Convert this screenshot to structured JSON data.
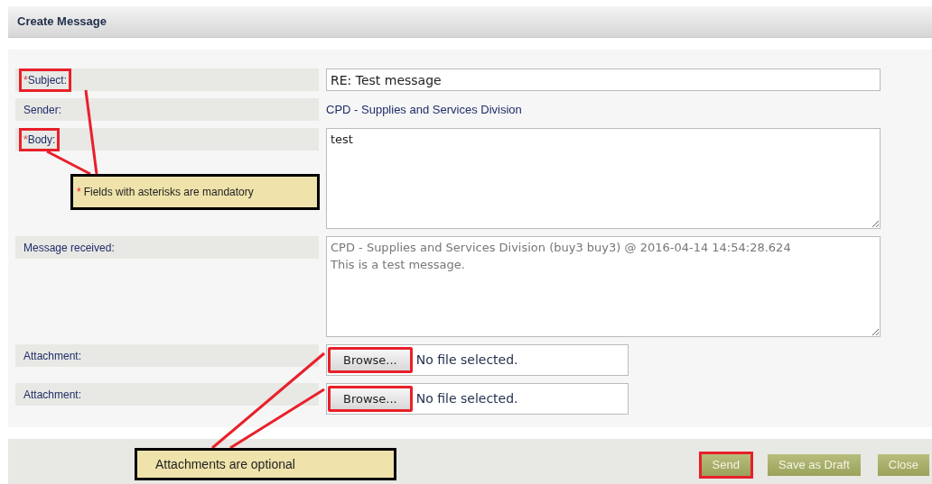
{
  "header": {
    "title": "Create Message"
  },
  "fields": [
    {
      "kind": "text",
      "mark": "*",
      "label": "Subject:",
      "highlighted": true,
      "value": "RE: Test message"
    },
    {
      "kind": "static",
      "label": "Sender:",
      "highlighted": false,
      "value": "CPD - Supplies and Services Division"
    },
    {
      "kind": "textarea",
      "mark": "*",
      "label": "Body:",
      "highlighted": true,
      "value": "test"
    },
    {
      "kind": "readonly",
      "label": "Message received:",
      "highlighted": false,
      "value": "CPD - Supplies and Services Division (buy3 buy3) @ 2016-04-14 14:54:28.624\nThis is a test message."
    },
    {
      "kind": "file",
      "label": "Attachment:",
      "highlighted": false,
      "button": "Browse...",
      "button_highlighted": true,
      "value": "No file selected."
    },
    {
      "kind": "file",
      "label": "Attachment:",
      "highlighted": false,
      "button": "Browse...",
      "button_highlighted": true,
      "value": "No file selected."
    }
  ],
  "buttons": [
    {
      "label": "Send",
      "highlighted": true
    },
    {
      "label": "Save as Draft",
      "highlighted": false
    },
    {
      "label": "Close",
      "highlighted": false
    }
  ],
  "callouts": [
    {
      "marker": "*",
      "text": "Fields with asterisks are mandatory"
    },
    {
      "text": "Attachments are optional"
    }
  ]
}
